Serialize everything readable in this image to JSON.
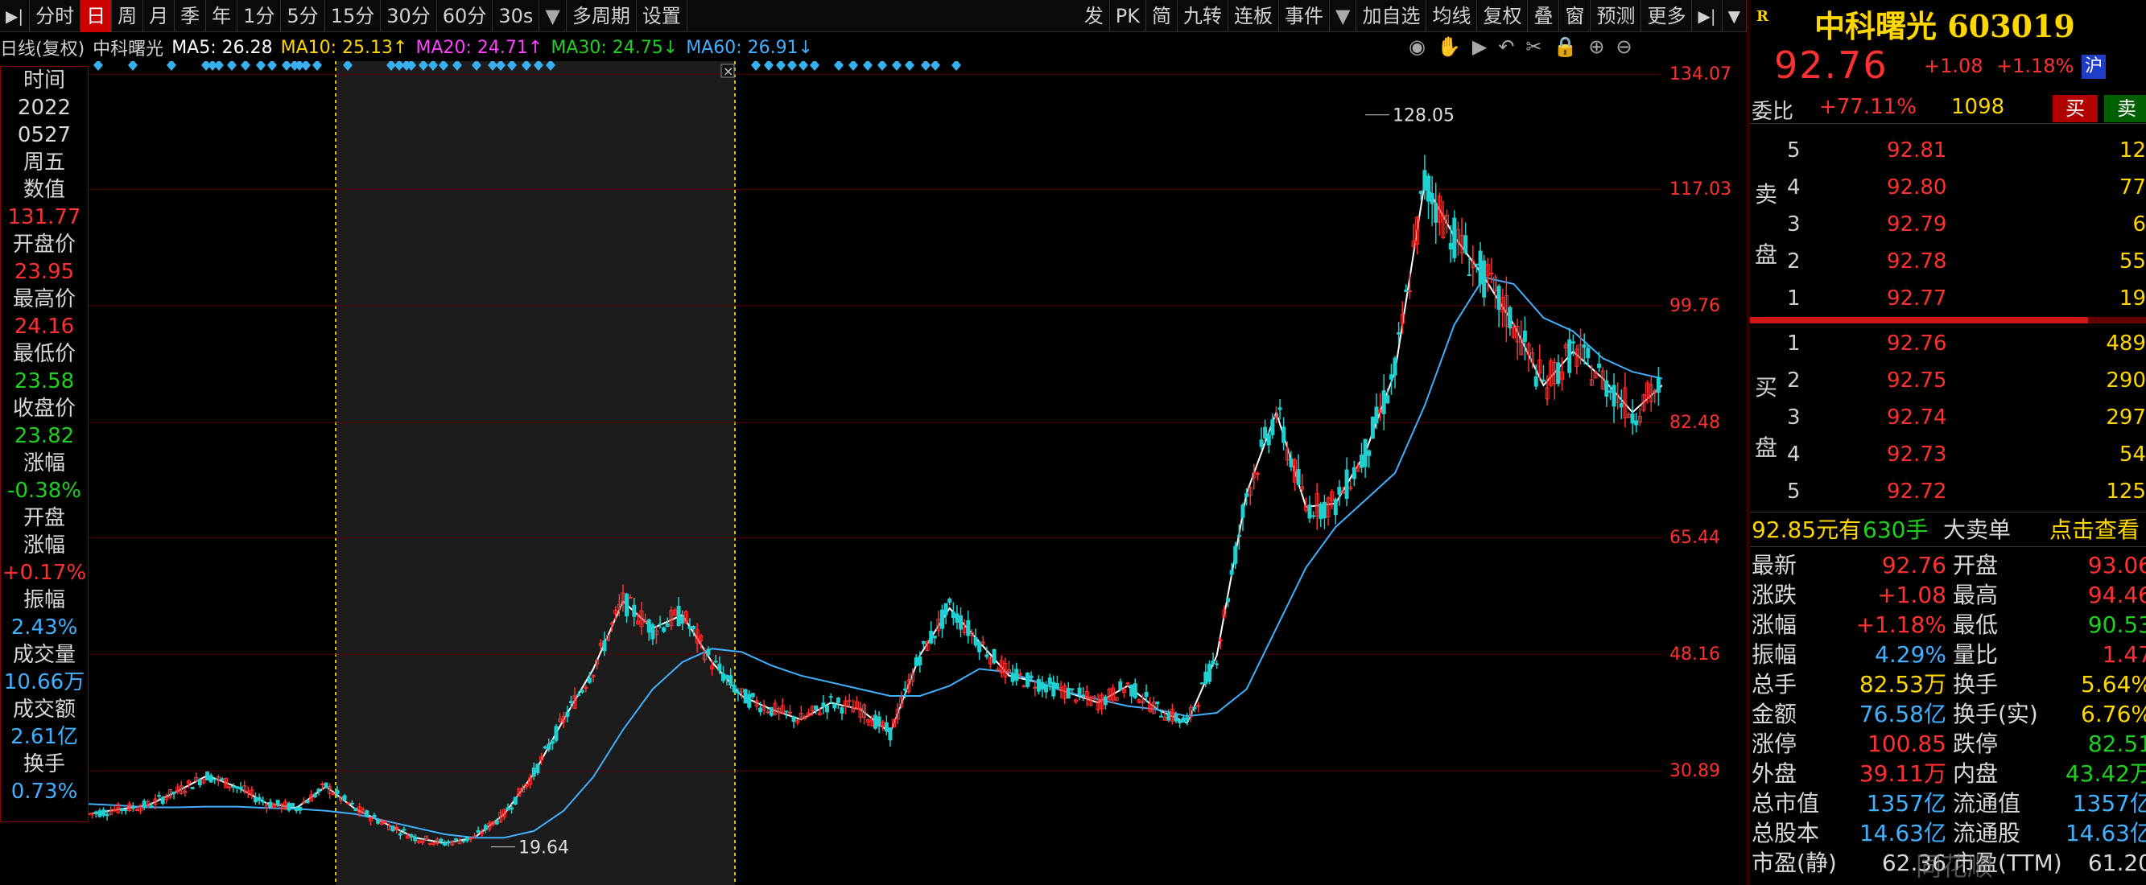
{
  "toolbar": {
    "items": [
      "分时",
      "日",
      "周",
      "月",
      "季",
      "年",
      "1分",
      "5分",
      "15分",
      "30分",
      "60分",
      "30s",
      "多周期",
      "设置"
    ],
    "active": "日",
    "right_items": [
      "发",
      "PK",
      "简",
      "九转",
      "连板",
      "事件",
      "加自选",
      "均线",
      "复权",
      "叠",
      "窗",
      "预测",
      "更多"
    ]
  },
  "ma_bar": {
    "prefix": "日线(复权)",
    "stock": "中科曙光",
    "ma5": "MA5: 26.28",
    "ma10": "MA10: 25.13↑",
    "ma20": "MA20: 24.71↑",
    "ma30": "MA30: 24.75↓",
    "ma60": "MA60: 26.91↓"
  },
  "colors": {
    "ma5": "#ffffff",
    "ma10": "#ffd700",
    "ma20": "#ff40ff",
    "ma30": "#20d020",
    "ma60": "#40b0ff",
    "up": "#ff3030",
    "down": "#20d020",
    "cyan": "#40b0ff"
  },
  "info_panel": [
    {
      "t": "时间",
      "c": "lbl"
    },
    {
      "t": "2022",
      "c": "lbl"
    },
    {
      "t": "0527",
      "c": "lbl"
    },
    {
      "t": "周五",
      "c": "lbl"
    },
    {
      "t": "数值",
      "c": "lbl"
    },
    {
      "t": "131.77",
      "c": "red"
    },
    {
      "t": "开盘价",
      "c": "lbl"
    },
    {
      "t": "23.95",
      "c": "red"
    },
    {
      "t": "最高价",
      "c": "lbl"
    },
    {
      "t": "24.16",
      "c": "red"
    },
    {
      "t": "最低价",
      "c": "lbl"
    },
    {
      "t": "23.58",
      "c": "green"
    },
    {
      "t": "收盘价",
      "c": "lbl"
    },
    {
      "t": "23.82",
      "c": "green"
    },
    {
      "t": "涨幅",
      "c": "lbl"
    },
    {
      "t": "-0.38%",
      "c": "green"
    },
    {
      "t": "开盘",
      "c": "lbl"
    },
    {
      "t": "涨幅",
      "c": "lbl"
    },
    {
      "t": "+0.17%",
      "c": "red"
    },
    {
      "t": "振幅",
      "c": "lbl"
    },
    {
      "t": "2.43%",
      "c": "cyan"
    },
    {
      "t": "成交量",
      "c": "lbl"
    },
    {
      "t": "10.66万",
      "c": "cyan"
    },
    {
      "t": "成交额",
      "c": "lbl"
    },
    {
      "t": "2.61亿",
      "c": "cyan"
    },
    {
      "t": "换手",
      "c": "lbl"
    },
    {
      "t": "0.73%",
      "c": "cyan"
    }
  ],
  "y_axis": [
    "134.07",
    "117.03",
    "99.76",
    "82.48",
    "65.44",
    "48.16",
    "30.89"
  ],
  "annotations": {
    "high": "128.05",
    "low": "19.64"
  },
  "chart_data": {
    "type": "line",
    "title": "",
    "ylim": [
      14.0,
      136.0
    ],
    "y_ticks": [
      134.07,
      117.03,
      99.76,
      82.48,
      65.44,
      48.16,
      30.89
    ],
    "series": [
      {
        "name": "MA5",
        "values": [
          24.5,
          25.2,
          25.8,
          27.9,
          30.2,
          28.5,
          26.1,
          25.4,
          28.6,
          25.2,
          23.1,
          21.0,
          20.2,
          21.0,
          24.5,
          30.5,
          38.5,
          46.0,
          56.0,
          52.0,
          54.0,
          47.0,
          42.0,
          40.0,
          38.5,
          41.0,
          40.0,
          36.5,
          48.0,
          55.0,
          50.0,
          45.0,
          44.0,
          42.5,
          41.0,
          43.5,
          40.0,
          38.0,
          48.0,
          72.0,
          84.0,
          70.0,
          70.5,
          78.0,
          90.0,
          118.0,
          110.0,
          104.0,
          97.0,
          88.0,
          93.0,
          89.0,
          84.0,
          88.0
        ]
      },
      {
        "name": "MA60",
        "values": [
          26.0,
          25.8,
          25.5,
          25.5,
          25.6,
          25.6,
          25.4,
          25.3,
          25.0,
          24.5,
          23.5,
          22.5,
          21.5,
          21.0,
          21.0,
          22.0,
          25.0,
          30.0,
          37.0,
          43.0,
          47.0,
          49.0,
          48.5,
          46.5,
          45.0,
          44.0,
          43.0,
          42.0,
          42.0,
          43.5,
          46.0,
          45.5,
          44.0,
          42.5,
          41.5,
          40.5,
          40.0,
          39.0,
          39.5,
          43.0,
          52.0,
          61.0,
          67.0,
          71.0,
          75.0,
          85.0,
          97.0,
          104.0,
          103.0,
          98.0,
          96.0,
          92.0,
          90.0,
          89.0
        ]
      }
    ]
  },
  "right": {
    "flag": "R",
    "name": "中科曙光 603019",
    "price": "92.76",
    "change": "+1.08",
    "change_pct": "+1.18%",
    "exchange": "沪",
    "weibi_label": "委比",
    "weibi_value": "+77.11%",
    "weibi_vol": "1098",
    "buy_label": "买",
    "sell_label": "卖",
    "sell_side": "卖盘",
    "buy_side": "买盘",
    "asks": [
      {
        "lvl": "5",
        "px": "92.81",
        "vol": "12"
      },
      {
        "lvl": "4",
        "px": "92.80",
        "vol": "77"
      },
      {
        "lvl": "3",
        "px": "92.79",
        "vol": "6"
      },
      {
        "lvl": "2",
        "px": "92.78",
        "vol": "55"
      },
      {
        "lvl": "1",
        "px": "92.77",
        "vol": "19"
      }
    ],
    "bids": [
      {
        "lvl": "1",
        "px": "92.76",
        "vol": "489"
      },
      {
        "lvl": "2",
        "px": "92.75",
        "vol": "290"
      },
      {
        "lvl": "3",
        "px": "92.74",
        "vol": "297"
      },
      {
        "lvl": "4",
        "px": "92.73",
        "vol": "54"
      },
      {
        "lvl": "5",
        "px": "92.72",
        "vol": "125"
      }
    ],
    "big_order": {
      "price": "92.85元有",
      "qty": "630手",
      "label": "大卖单",
      "link": "点击查看"
    },
    "stats": [
      {
        "k1": "最新",
        "v1": "92.76",
        "c1": "red",
        "k2": "开盘",
        "v2": "93.06",
        "c2": "red"
      },
      {
        "k1": "涨跌",
        "v1": "+1.08",
        "c1": "red",
        "k2": "最高",
        "v2": "94.46",
        "c2": "red"
      },
      {
        "k1": "涨幅",
        "v1": "+1.18%",
        "c1": "red",
        "k2": "最低",
        "v2": "90.53",
        "c2": "green"
      },
      {
        "k1": "振幅",
        "v1": "4.29%",
        "c1": "cyan",
        "k2": "量比",
        "v2": "1.47",
        "c2": "red"
      },
      {
        "k1": "总手",
        "v1": "82.53万",
        "c1": "yellow",
        "k2": "换手",
        "v2": "5.64%",
        "c2": "yellow"
      },
      {
        "k1": "金额",
        "v1": "76.58亿",
        "c1": "cyan",
        "k2": "换手(实)",
        "v2": "6.76%",
        "c2": "yellow"
      },
      {
        "k1": "涨停",
        "v1": "100.85",
        "c1": "red",
        "k2": "跌停",
        "v2": "82.51",
        "c2": "green"
      },
      {
        "k1": "外盘",
        "v1": "39.11万",
        "c1": "red",
        "k2": "内盘",
        "v2": "43.42万",
        "c2": "green"
      },
      {
        "k1": "总市值",
        "v1": "1357亿",
        "c1": "cyan",
        "k2": "流通值",
        "v2": "1357亿",
        "c2": "cyan"
      },
      {
        "k1": "总股本",
        "v1": "14.63亿",
        "c1": "cyan",
        "k2": "流通股",
        "v2": "14.63亿",
        "c2": "cyan"
      },
      {
        "k1": "市盈(静)",
        "v1": "62.36",
        "c1": "lbl",
        "k2": "市盈(TTM)",
        "v2": "61.20",
        "c2": "lbl"
      }
    ],
    "watermark": "同花顺"
  }
}
